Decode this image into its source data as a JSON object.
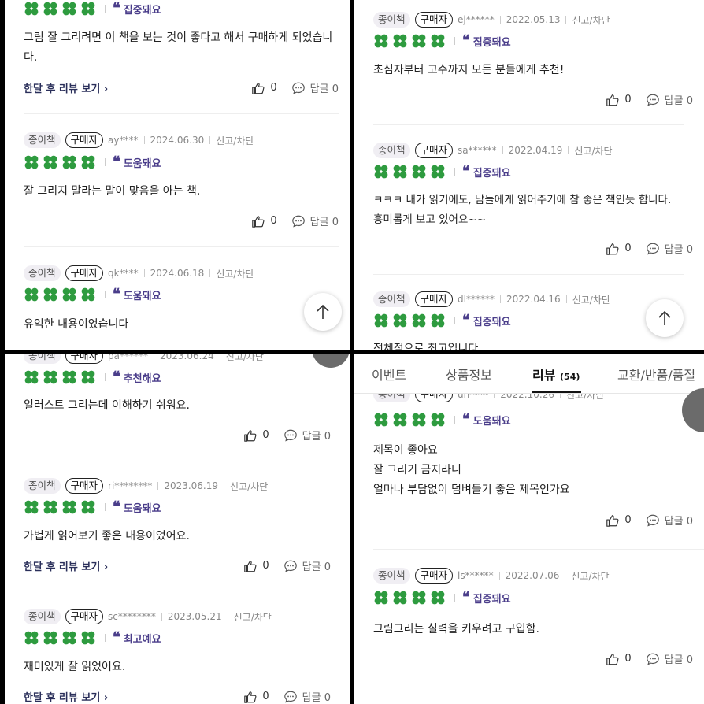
{
  "tag_paper": "종이책",
  "tag_buyer": "구매자",
  "report": "신고/차단",
  "reply": "답글",
  "more": "한달 후 리뷰 보기",
  "colors": {
    "accent": "#4a3d8a",
    "clover": "#2e9b3f"
  },
  "icons": [
    "clover-icon",
    "quote-icon",
    "thumbs-up-icon",
    "comment-icon",
    "chevron-right-icon",
    "arrow-up-icon"
  ],
  "tabs": {
    "event": "이벤트",
    "info": "상품정보",
    "review": "리뷰",
    "review_count": "(54)",
    "exchange": "교환/반품/품절"
  },
  "reviews": [
    {
      "rating_label": "집중돼요",
      "text": "그림 잘 그리려면 이 책을 보는 것이 좋다고 해서 구매하게 되었습니다.",
      "likes": "0",
      "replies": "0"
    },
    {
      "user": "ay****",
      "date": "2024.06.30",
      "rating_label": "도움돼요",
      "text": "잘 그리지 말라는 말이 맞음을 아는 책.",
      "likes": "0",
      "replies": "0"
    },
    {
      "user": "qk****",
      "date": "2024.06.18",
      "rating_label": "도움돼요",
      "text": "유익한 내용이었습니다"
    },
    {
      "user": "ej******",
      "date": "2022.05.13",
      "rating_label": "집중돼요",
      "text": "초심자부터 고수까지 모든 분들에게 추천!",
      "likes": "0",
      "replies": "0"
    },
    {
      "user": "sa******",
      "date": "2022.04.19",
      "rating_label": "집중돼요",
      "text": "ㅋㅋㅋ 내가 읽기에도, 남들에게 읽어주기에 참 좋은 책인듯 합니다. 흥미롭게 보고 있어요~~",
      "likes": "0",
      "replies": "0"
    },
    {
      "user": "dl******",
      "date": "2022.04.16",
      "rating_label": "집중돼요",
      "text": "전체적으로 최고입니다"
    },
    {
      "user": "pa******",
      "date": "2023.06.24",
      "rating_label": "추천해요",
      "text": "일러스트 그리는데 이해하기 쉬워요.",
      "likes": "0",
      "replies": "0"
    },
    {
      "user": "ri********",
      "date": "2023.06.19",
      "rating_label": "도움돼요",
      "text": "가볍게 읽어보기 좋은 내용이었어요.",
      "likes": "0",
      "replies": "0"
    },
    {
      "user": "sc********",
      "date": "2023.05.21",
      "rating_label": "최고예요",
      "text": "재미있게 잘 읽었어요.",
      "likes": "0",
      "replies": "0"
    },
    {
      "user": "un****",
      "date": "2022.10.26",
      "rating_label": "도움돼요",
      "text_lines": [
        "제목이 좋아요",
        "잘 그리기 금지라니",
        "얼마나 부담없이 덤벼들기 좋은 제목인가요"
      ],
      "likes": "0",
      "replies": "0"
    },
    {
      "user": "ls******",
      "date": "2022.07.06",
      "rating_label": "집중돼요",
      "text": "그림그리는 실력을 키우려고 구입함.",
      "likes": "0",
      "replies": "0"
    }
  ]
}
